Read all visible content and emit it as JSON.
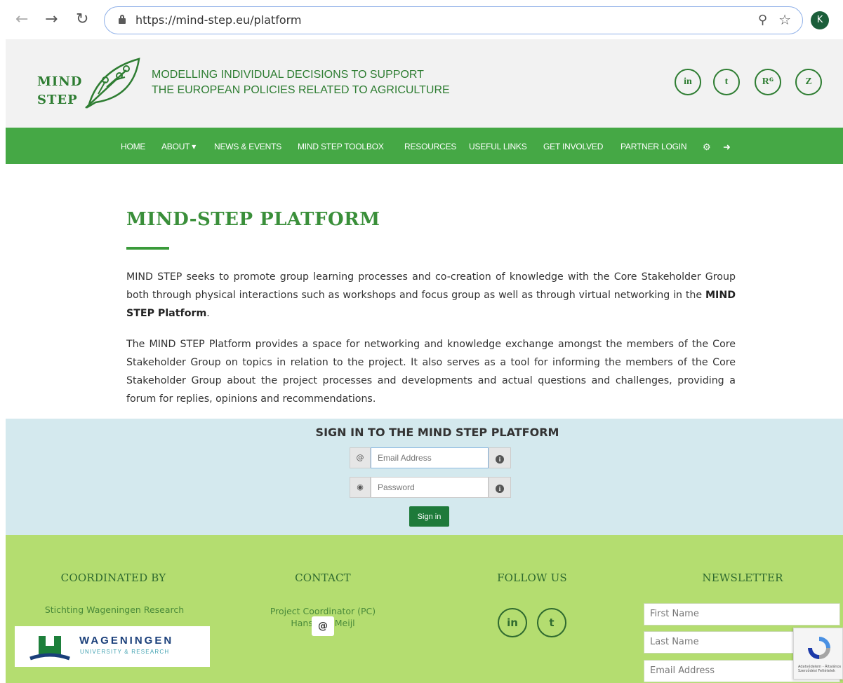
{
  "browser": {
    "url": "https://mind-step.eu/platform",
    "back_icon": "arrow-left-icon",
    "forward_icon": "arrow-right-icon",
    "reload_icon": "reload-icon",
    "profile_initial": "K"
  },
  "header": {
    "logo_line1": "MIND",
    "logo_line2": "STEP",
    "tagline_line1": "MODELLING INDIVIDUAL DECISIONS TO SUPPORT",
    "tagline_line2": "THE EUROPEAN POLICIES RELATED TO AGRICULTURE",
    "social": [
      {
        "label": "in",
        "icon": "linkedin-icon"
      },
      {
        "label": "t",
        "icon": "twitter-icon"
      },
      {
        "label": "Rᴳ",
        "icon": "researchgate-icon"
      },
      {
        "label": "Z",
        "icon": "zenodo-icon"
      }
    ]
  },
  "nav": {
    "items": [
      "HOME",
      "ABOUT ▾",
      "NEWS & EVENTS",
      "MIND STEP TOOLBOX",
      "RESOURCES",
      "USEFUL LINKS",
      "GET INVOLVED",
      "PARTNER LOGIN"
    ],
    "settings_icon": "gears-icon",
    "logout_icon": "sign-out-icon"
  },
  "main": {
    "title": "MIND-STEP PLATFORM",
    "para1_text": "MIND STEP seeks to promote group learning processes and co-creation of knowledge with the Core Stakeholder Group both through physical interactions such as workshops and focus group as well as through virtual networking in the ",
    "para1_bold": "MIND STEP Platform",
    "para1_end": ".",
    "para2": "The MIND STEP Platform provides a space for networking and knowledge exchange amongst the members of the Core Stakeholder Group on topics in relation to the project. It also serves as a tool for informing the members of the Core Stakeholder Group about the project processes and developments and actual questions and challenges, providing a forum for replies, opinions and recommendations."
  },
  "signin": {
    "title": "SIGN IN TO THE MIND STEP PLATFORM",
    "email_placeholder": "Email Address",
    "password_placeholder": "Password",
    "button": "Sign in"
  },
  "footer": {
    "coordinated_by": "COORDINATED BY",
    "coordinator_name": "Stichting Wageningen Research",
    "wur_name": "WAGENINGEN",
    "wur_sub": "UNIVERSITY & RESEARCH",
    "contact": "CONTACT",
    "contact_line1": "Project Coordinator (PC)",
    "contact_line2": "Hans van Meijl",
    "contact_button": "@",
    "follow_us": "FOLLOW US",
    "newsletter": "NEWSLETTER",
    "newsletter_fields": [
      "First Name",
      "Last Name",
      "Email Address"
    ],
    "recaptcha_note": "Adatvédelem - Általános Szerződési Feltételek"
  }
}
